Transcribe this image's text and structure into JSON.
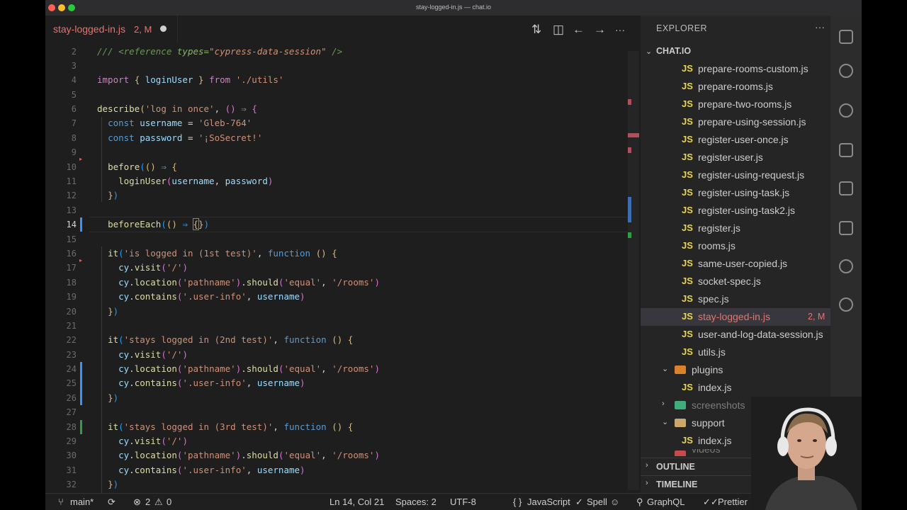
{
  "window": {
    "title": "stay-logged-in.js — chat.io"
  },
  "tab": {
    "filename": "stay-logged-in.js",
    "status": "2, M"
  },
  "editor": {
    "line_numbers": [
      "2",
      "3",
      "4",
      "5",
      "6",
      "7",
      "8",
      "9",
      "10",
      "11",
      "12",
      "13",
      "14",
      "15",
      "16",
      "17",
      "18",
      "19",
      "20",
      "21",
      "22",
      "23",
      "24",
      "25",
      "26",
      "27",
      "28",
      "29",
      "30",
      "31",
      "32"
    ],
    "current_line": "14"
  },
  "explorer": {
    "title": "EXPLORER",
    "more": "···",
    "project": "CHAT.IO",
    "files": [
      {
        "name": "prepare-rooms-custom.js",
        "badge": "JS"
      },
      {
        "name": "prepare-rooms.js",
        "badge": "JS"
      },
      {
        "name": "prepare-two-rooms.js",
        "badge": "JS"
      },
      {
        "name": "prepare-using-session.js",
        "badge": "JS"
      },
      {
        "name": "register-user-once.js",
        "badge": "JS"
      },
      {
        "name": "register-user.js",
        "badge": "JS"
      },
      {
        "name": "register-using-request.js",
        "badge": "JS"
      },
      {
        "name": "register-using-task.js",
        "badge": "JS"
      },
      {
        "name": "register-using-task2.js",
        "badge": "JS"
      },
      {
        "name": "register.js",
        "badge": "JS"
      },
      {
        "name": "rooms.js",
        "badge": "JS"
      },
      {
        "name": "same-user-copied.js",
        "badge": "JS"
      },
      {
        "name": "socket-spec.js",
        "badge": "JS"
      },
      {
        "name": "spec.js",
        "badge": "JS"
      },
      {
        "name": "stay-logged-in.js",
        "badge": "JS",
        "status": "2, M"
      },
      {
        "name": "user-and-log-data-session.js",
        "badge": "JS"
      },
      {
        "name": "utils.js",
        "badge": "JS"
      }
    ],
    "folders": {
      "plugins": "plugins",
      "plugins_index": "index.js",
      "screenshots": "screenshots",
      "support": "support",
      "support_index": "index.js",
      "videos": "videos"
    },
    "outline": "OUTLINE",
    "timeline": "TIMELINE"
  },
  "statusbar": {
    "branch": "main*",
    "errors": "2",
    "warnings": "0",
    "position": "Ln 14, Col 21",
    "spaces": "Spaces: 2",
    "encoding": "UTF-8",
    "language": "JavaScript",
    "spell": "Spell",
    "graphql": "GraphQL",
    "prettier": "Prettier"
  },
  "colors": {
    "modified": "#e5746f",
    "js_badge": "#e8d44d",
    "selection": "#37373d"
  }
}
